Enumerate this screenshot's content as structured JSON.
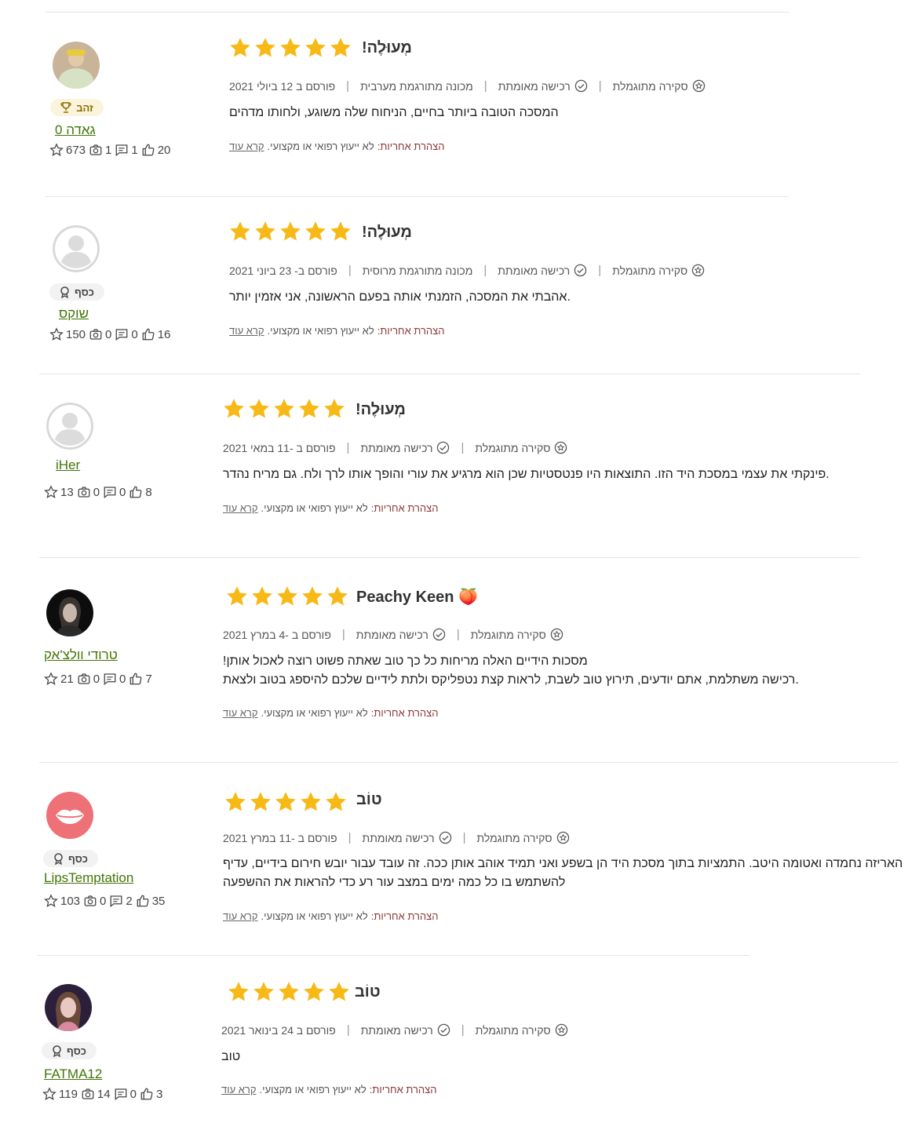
{
  "colors": {
    "star": "#f7b916",
    "link": "#417505",
    "accent_gold": "#8a6d00"
  },
  "common": {
    "featured": "סקירה מתוגמלת",
    "verified": "רכישה מאומתת",
    "disclaimer_label": "הצהרת אחריות:",
    "disclaimer_text": "לא ייעוץ רפואי או מקצועי.",
    "read_more": "קרא עוד"
  },
  "reviews": [
    {
      "rating": 5,
      "title": "!מְעוּלֶה",
      "translated": "מכונה מתורגמת מערבית",
      "date": "פורסם ב 12 ביולי 2021",
      "body": [
        "המסכה הטובה ביותר בחיים, הניחוח שלה משוגע, ולחותו מדהים"
      ],
      "user": {
        "name": "גאדה 0",
        "badge": "זהב",
        "badge_icon": "trophy-icon",
        "avatar": "photo-avatar-icon",
        "stars": "673",
        "photos": "1",
        "comments": "1",
        "likes": "20"
      }
    },
    {
      "rating": 5,
      "title": "!מְעוּלֶה",
      "translated": "מכונה מתורגמת מרוסית",
      "date": "פורסם ב- 23 ביוני 2021",
      "body": [
        ".אהבתי את המסכה, הזמנתי אותה בפעם הראשונה, אני אזמין יותר"
      ],
      "user": {
        "name": "שוקס",
        "badge": "כסף",
        "badge_icon": "medal-icon",
        "avatar": "default-avatar-icon",
        "stars": "150",
        "photos": "0",
        "comments": "0",
        "likes": "16"
      }
    },
    {
      "rating": 5,
      "title": "!מְעוּלֶה",
      "translated": "",
      "date": "פורסם ב -11 במאי 2021",
      "body": [
        ".פינקתי את עצמי במסכת היד הזו. התוצאות היו פנטסטיות שכן הוא מרגיע את עורי והופך אותו לרך ולח. גם מריח נהדר"
      ],
      "user": {
        "name": "iHer",
        "badge": "",
        "badge_icon": "",
        "avatar": "default-avatar-icon",
        "stars": "13",
        "photos": "0",
        "comments": "0",
        "likes": "8"
      }
    },
    {
      "rating": 5,
      "title": "Peachy Keen 🍑",
      "translated": "",
      "date": "פורסם ב -4 במרץ 2021",
      "body": [
        "מסכות הידיים האלה מריחות כל כך טוב שאתה פשוט רוצה לאכול אותן!",
        ".רכישה משתלמת, אתם יודעים, תירוץ טוב לשבת, לראות קצת נטפליקס ולתת לידיים שלכם להיספג בטוב ולצאת"
      ],
      "user": {
        "name": "טרודי וולצ'אק",
        "badge": "",
        "badge_icon": "",
        "avatar": "photo-avatar-icon",
        "stars": "21",
        "photos": "0",
        "comments": "0",
        "likes": "7"
      }
    },
    {
      "rating": 5,
      "title": "טוֹב",
      "translated": "",
      "date": "פורסם ב -11 במרץ 2021",
      "body": [
        "האריזה נחמדה ואטומה היטב. התמציות בתוך מסכת היד הן בשפע ואני תמיד אוהב אותן ככה. זה עובד עבור יובש חירום בידיים, עדיף",
        "להשתמש בו כל כמה ימים במצב עור רע כדי להראות את ההשפעה"
      ],
      "user": {
        "name": "LipsTemptation",
        "badge": "כסף",
        "badge_icon": "medal-icon",
        "avatar": "lips-avatar-icon",
        "stars": "103",
        "photos": "0",
        "comments": "2",
        "likes": "35"
      }
    },
    {
      "rating": 5,
      "title": "טוֹב",
      "translated": "",
      "date": "פורסם ב 24 בינואר 2021",
      "body": [
        "טוב"
      ],
      "user": {
        "name": "FATMA12",
        "badge": "כסף",
        "badge_icon": "medal-icon",
        "avatar": "photo-avatar-icon",
        "stars": "119",
        "photos": "14",
        "comments": "0",
        "likes": "3"
      }
    }
  ]
}
